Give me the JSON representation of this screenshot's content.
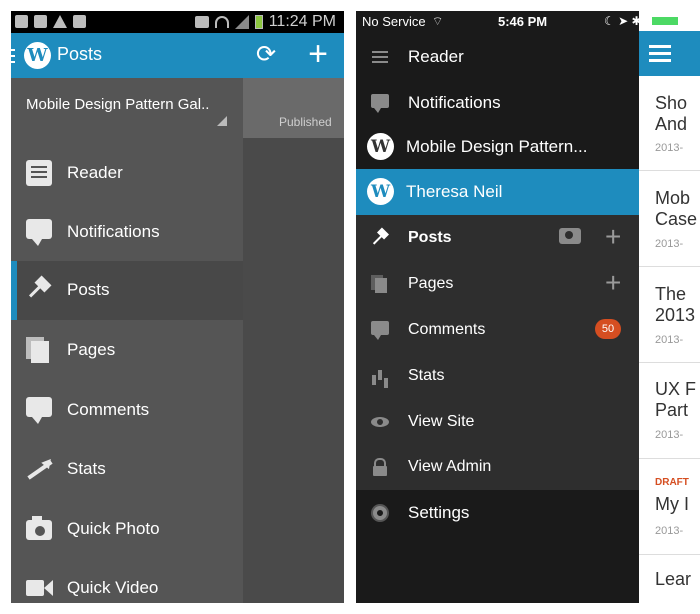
{
  "android": {
    "status_time": "11:24 PM",
    "app_title": "Posts",
    "blog_name": "Mobile Design Pattern Gal..",
    "content_tab": "Published",
    "menu": [
      {
        "label": "Reader",
        "icon": "reader-icon"
      },
      {
        "label": "Notifications",
        "icon": "notifications-icon"
      },
      {
        "label": "Posts",
        "icon": "pushpin-icon",
        "active": true
      },
      {
        "label": "Pages",
        "icon": "pages-icon"
      },
      {
        "label": "Comments",
        "icon": "comments-icon"
      },
      {
        "label": "Stats",
        "icon": "stats-icon"
      },
      {
        "label": "Quick Photo",
        "icon": "camera-icon"
      },
      {
        "label": "Quick Video",
        "icon": "video-icon"
      }
    ]
  },
  "ios": {
    "status": {
      "carrier": "No Service",
      "time": "5:46 PM"
    },
    "menu": {
      "reader": "Reader",
      "notifications": "Notifications",
      "blog": "Mobile Design Pattern...",
      "account": "Theresa Neil",
      "posts": "Posts",
      "pages": "Pages",
      "comments": "Comments",
      "comments_badge": "50",
      "stats": "Stats",
      "view_site": "View Site",
      "view_admin": "View Admin",
      "settings": "Settings"
    },
    "posts_list": [
      {
        "title1": "Sho",
        "title2": "And",
        "date": "2013-"
      },
      {
        "title1": "Mob",
        "title2": "Case",
        "date": "2013-"
      },
      {
        "title1": "The",
        "title2": "2013",
        "date": "2013-"
      },
      {
        "title1": "UX F",
        "title2": "Part",
        "date": "2013-"
      },
      {
        "draft": "DRAFT",
        "title1": "My I",
        "date": "2013-"
      },
      {
        "title1": "Lear"
      }
    ]
  },
  "colors": {
    "wp_blue": "#1e8cbe",
    "badge": "#d54e21",
    "draft": "#d54e21"
  }
}
